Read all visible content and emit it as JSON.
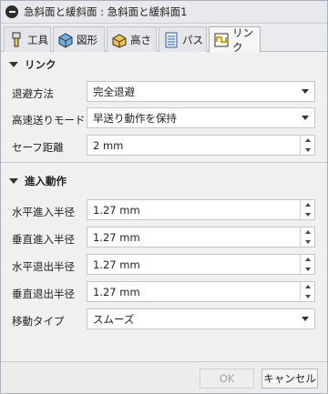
{
  "window": {
    "title": "急斜面と緩斜面 : 急斜面と緩斜面1"
  },
  "tabs": [
    {
      "label": "工具",
      "icon": "tool-icon"
    },
    {
      "label": "図形",
      "icon": "geometry-icon"
    },
    {
      "label": "高さ",
      "icon": "heights-icon"
    },
    {
      "label": "パス",
      "icon": "passes-icon"
    },
    {
      "label": "リンク",
      "icon": "linking-icon",
      "active": true
    }
  ],
  "link_section": {
    "title": "リンク",
    "retract_policy": {
      "label": "退避方法",
      "value": "完全退避"
    },
    "high_feed": {
      "label": "高速送りモード",
      "value": "早送り動作を保持"
    },
    "safe_distance": {
      "label": "セーフ距離",
      "value": "2 mm"
    }
  },
  "entry_section": {
    "title": "進入動作",
    "horizontal_lead_in": {
      "label": "水平進入半径",
      "value": "1.27 mm"
    },
    "vertical_lead_in": {
      "label": "垂直進入半径",
      "value": "1.27 mm"
    },
    "horizontal_lead_out": {
      "label": "水平退出半径",
      "value": "1.27 mm"
    },
    "vertical_lead_out": {
      "label": "垂直退出半径",
      "value": "1.27 mm"
    },
    "transition_type": {
      "label": "移動タイプ",
      "value": "スムーズ"
    }
  },
  "footer": {
    "ok_label": "OK",
    "cancel_label": "キャンセル"
  }
}
